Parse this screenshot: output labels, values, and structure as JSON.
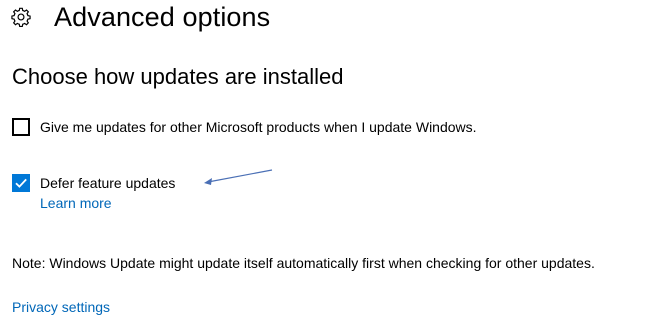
{
  "header": {
    "icon": "gear-icon",
    "title": "Advanced options"
  },
  "section": {
    "title": "Choose how updates are installed"
  },
  "options": {
    "microsoft_products": {
      "label": "Give me updates for other Microsoft products when I update Windows.",
      "checked": false
    },
    "defer_feature_updates": {
      "label": "Defer feature updates",
      "checked": true
    }
  },
  "links": {
    "learn_more": "Learn more",
    "privacy_settings": "Privacy settings"
  },
  "note": "Note: Windows Update might update itself automatically first when checking for other updates.",
  "colors": {
    "accent": "#0078d7",
    "link": "#0067b8",
    "annotation_arrow": "#4a6fb5"
  }
}
